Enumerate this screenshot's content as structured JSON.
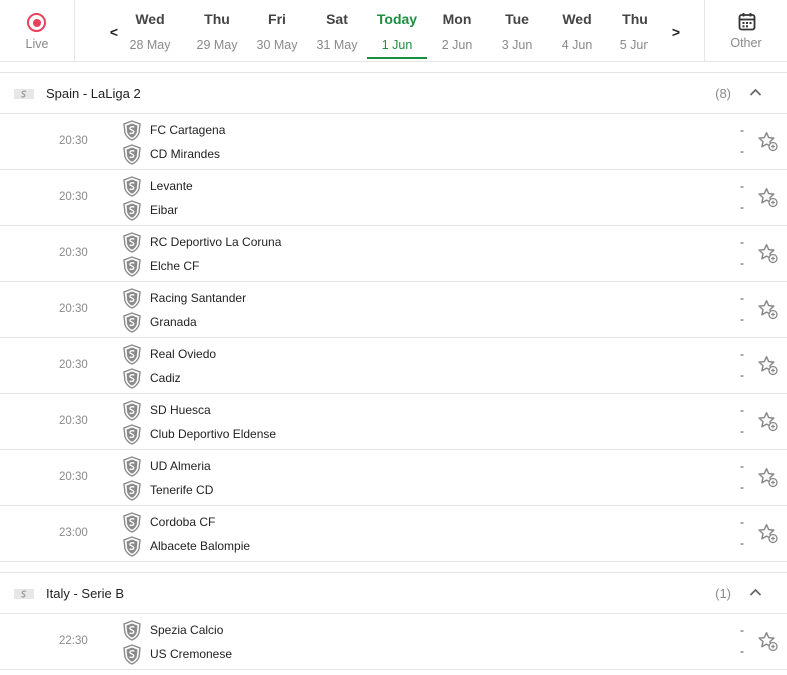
{
  "nav": {
    "live_label": "Live",
    "prev_arrow": "<",
    "next_arrow": ">",
    "other_label": "Other",
    "days": [
      {
        "name": "Wed",
        "date": "28 May",
        "active": false
      },
      {
        "name": "Thu",
        "date": "29 May",
        "active": false
      },
      {
        "name": "Fri",
        "date": "30 May",
        "active": false
      },
      {
        "name": "Sat",
        "date": "31 May",
        "active": false
      },
      {
        "name": "Today",
        "date": "1 Jun",
        "active": true
      },
      {
        "name": "Mon",
        "date": "2 Jun",
        "active": false
      },
      {
        "name": "Tue",
        "date": "3 Jun",
        "active": false
      },
      {
        "name": "Wed",
        "date": "4 Jun",
        "active": false
      },
      {
        "name": "Thu",
        "date": "5 Jun",
        "active": false
      }
    ]
  },
  "colors": {
    "accent_green": "#1a8f3f",
    "live_red": "#e8415b",
    "muted_text": "#8a8a8a",
    "divider": "#e6e6e6"
  },
  "icons": {
    "live": "live-record-icon",
    "other": "calendar-icon",
    "flag": "flag-icon",
    "crest": "team-crest-icon",
    "collapse": "chevron-up-icon",
    "favorite": "star-add-icon"
  },
  "leagues": [
    {
      "name": "Spain - LaLiga 2",
      "count": "(8)",
      "matches": [
        {
          "time": "20:30",
          "home": "FC Cartagena",
          "away": "CD Mirandes",
          "home_score": "-",
          "away_score": "-"
        },
        {
          "time": "20:30",
          "home": "Levante",
          "away": "Eibar",
          "home_score": "-",
          "away_score": "-"
        },
        {
          "time": "20:30",
          "home": "RC Deportivo La Coruna",
          "away": "Elche CF",
          "home_score": "-",
          "away_score": "-"
        },
        {
          "time": "20:30",
          "home": "Racing Santander",
          "away": "Granada",
          "home_score": "-",
          "away_score": "-"
        },
        {
          "time": "20:30",
          "home": "Real Oviedo",
          "away": "Cadiz",
          "home_score": "-",
          "away_score": "-"
        },
        {
          "time": "20:30",
          "home": "SD Huesca",
          "away": "Club Deportivo Eldense",
          "home_score": "-",
          "away_score": "-"
        },
        {
          "time": "20:30",
          "home": "UD Almeria",
          "away": "Tenerife CD",
          "home_score": "-",
          "away_score": "-"
        },
        {
          "time": "23:00",
          "home": "Cordoba CF",
          "away": "Albacete Balompie",
          "home_score": "-",
          "away_score": "-"
        }
      ]
    },
    {
      "name": "Italy - Serie B",
      "count": "(1)",
      "matches": [
        {
          "time": "22:30",
          "home": "Spezia Calcio",
          "away": "US Cremonese",
          "home_score": "-",
          "away_score": "-"
        }
      ]
    }
  ]
}
